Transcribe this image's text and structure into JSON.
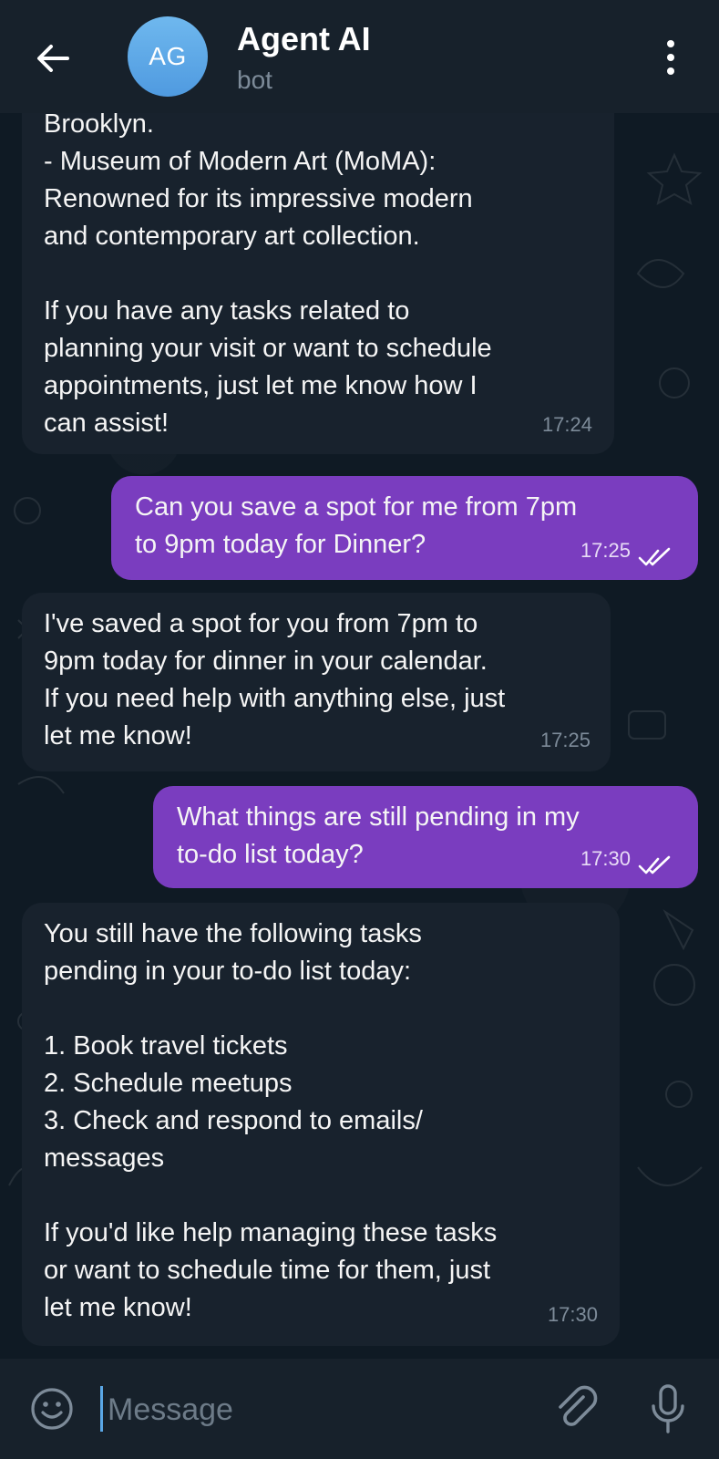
{
  "header": {
    "avatar_initials": "AG",
    "title": "Agent AI",
    "subtitle": "bot"
  },
  "messages": [
    {
      "direction": "incoming",
      "lines": [
        "Brooklyn.",
        "- Museum of Modern Art (MoMA):",
        "Renowned for its impressive modern",
        "and contemporary art collection.",
        "",
        "If you have any tasks related to",
        "planning your visit or want to schedule",
        "appointments, just let me know how I",
        "can assist!"
      ],
      "time": "17:24"
    },
    {
      "direction": "outgoing",
      "lines": [
        "Can you save a spot for me from 7pm",
        "to 9pm today for Dinner?"
      ],
      "time": "17:25",
      "status": "read"
    },
    {
      "direction": "incoming",
      "lines": [
        "I've saved a spot for you from 7pm to",
        "9pm today for dinner in your calendar.",
        "If you need help with anything else, just",
        "let me know!"
      ],
      "time": "17:25"
    },
    {
      "direction": "outgoing",
      "lines": [
        "What things are still pending in my",
        "to-do list today?"
      ],
      "time": "17:30",
      "status": "read"
    },
    {
      "direction": "incoming",
      "lines": [
        "You still have the following tasks",
        "pending in your to-do list today:",
        "",
        "1. Book travel tickets",
        "2. Schedule meetups",
        "3. Check and respond to emails/",
        "messages",
        "",
        "If you'd like help managing these tasks",
        "or want to schedule time for them, just",
        "let me know!"
      ],
      "time": "17:30"
    }
  ],
  "composer": {
    "placeholder": "Message"
  },
  "icons": {
    "back": "arrow-left-icon",
    "menu": "more-vertical-icon",
    "emoji": "smile-icon",
    "attach": "paperclip-icon",
    "mic": "microphone-icon",
    "read": "double-check-icon"
  },
  "colors": {
    "header_bg": "#17212b",
    "chat_bg": "#0f1a24",
    "incoming_bubble": "#18222d",
    "outgoing_bubble": "#7a3dbf",
    "avatar": "#5aa7e6"
  }
}
